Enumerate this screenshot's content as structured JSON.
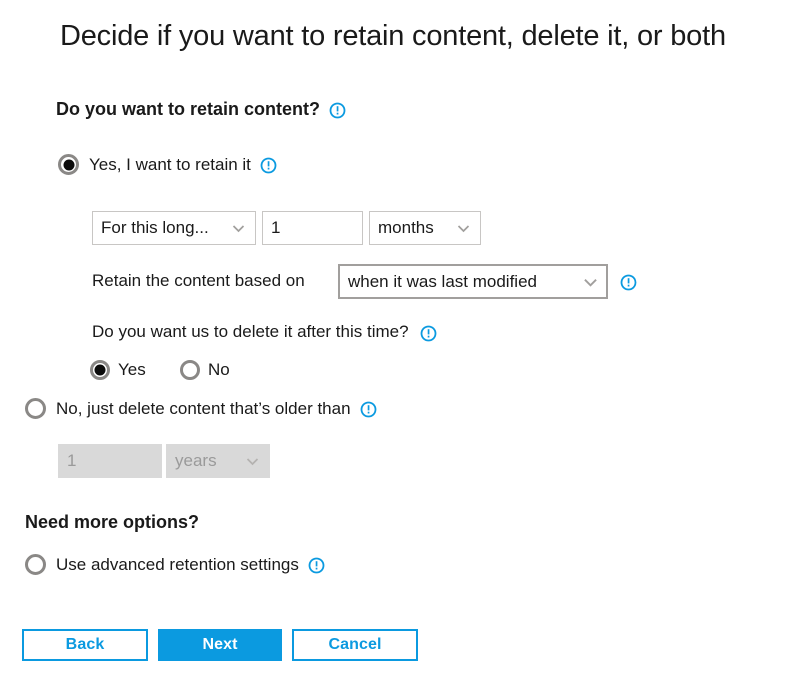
{
  "page": {
    "title": "Decide if you want to retain content, delete it, or both"
  },
  "icons": {
    "info": "info-exclamation-icon",
    "chevron": "chevron-down-icon"
  },
  "colors": {
    "accent": "#0b9ae0",
    "info_icon": "#0b9ae0",
    "radio_ring": "#8a8886",
    "field_border": "#c8c6c4",
    "disabled_fill": "#d9d9d9",
    "disabled_text": "#9a9a9a",
    "text": "#1a1a1a"
  },
  "retain_section": {
    "heading": "Do you want to retain content?",
    "options": [
      {
        "id": "yes-retain",
        "label": "Yes, I want to retain it",
        "selected": true
      },
      {
        "id": "no-delete",
        "label": "No, just delete content that’s older than",
        "selected": false
      }
    ],
    "duration": {
      "mode_value": "For this long...",
      "amount_value": "1",
      "unit_value": "months"
    },
    "basis": {
      "label": "Retain the content based on",
      "value": "when it was last modified"
    },
    "delete_after": {
      "question": "Do you want us to delete it after this time?",
      "options": [
        {
          "id": "delete-yes",
          "label": "Yes",
          "selected": true
        },
        {
          "id": "delete-no",
          "label": "No",
          "selected": false
        }
      ]
    },
    "delete_older_than": {
      "amount_value": "1",
      "unit_value": "years",
      "disabled": true
    }
  },
  "more_options_section": {
    "heading": "Need more options?",
    "option": {
      "id": "advanced",
      "label": "Use advanced retention settings",
      "selected": false
    }
  },
  "footer": {
    "back_label": "Back",
    "next_label": "Next",
    "cancel_label": "Cancel"
  }
}
